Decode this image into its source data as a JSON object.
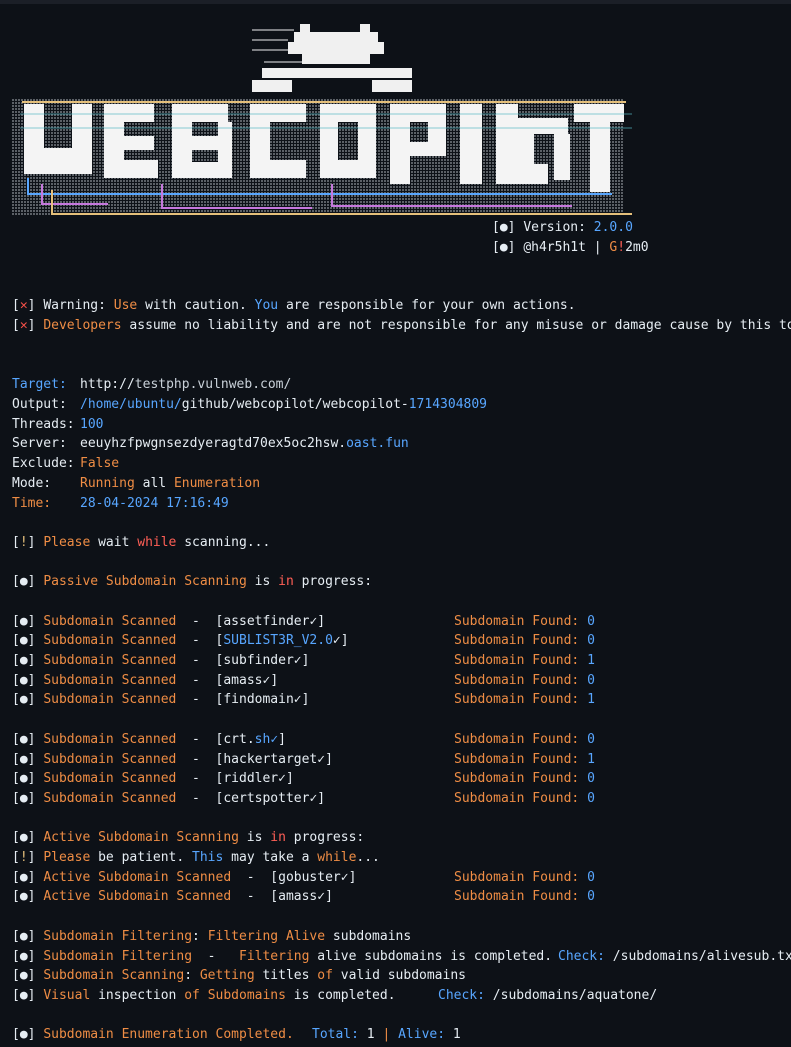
{
  "colors": {
    "background": "#0d1117",
    "orange": "#ef8d45",
    "blue": "#58a6ff",
    "red": "#ff5f56",
    "text": "#e6edf3"
  },
  "banner": {
    "version_label": "Version: ",
    "version": "2.0.0",
    "author": "@h4r5h1t",
    "sep": " | ",
    "author2_a": "G",
    "author2_b": "!",
    "author2_c": "2m0"
  },
  "warnings": [
    {
      "a": "Warning: ",
      "b": "Use",
      "c": " with caution. ",
      "d": "You",
      "e": " are responsible for your own actions."
    },
    {
      "a": "Developers",
      "b": " assume no liability and are not responsible for any misuse or damage cause by this tool"
    }
  ],
  "config": {
    "target_label": "Target:",
    "target_a": "http://",
    "target_b": "testphp.vulnweb.com/",
    "output_label": "Output:",
    "output_a": "/home/ubuntu/",
    "output_b": "github/webcopilot/webcopilot-",
    "output_c": "1714304809",
    "threads_label": "Threads:",
    "threads": "100",
    "server_label": "Server:",
    "server_a": "eeuyhzfpwgnsezdyeragtd70ex5oc2hsw.",
    "server_b": "oast.fun",
    "exclude_label": "Exclude:",
    "exclude": "False",
    "mode_label": "Mode:",
    "mode_a": "Running",
    "mode_b": " all ",
    "mode_c": "Enumeration",
    "time_label": "Time:",
    "time": "28-04-2024 17:16:49"
  },
  "wait": {
    "a": "Please",
    "b": " wait ",
    "c": "while",
    "d": " scanning..."
  },
  "passive_header": {
    "a": "Passive Subdomain Scanning",
    "b": " is ",
    "c": "in",
    "d": " progress:"
  },
  "scanned_label": "Subdomain Scanned",
  "found_label": "Subdomain Found: ",
  "check": "✓",
  "passive_group1": [
    {
      "tool": "assetfinder",
      "found": "0"
    },
    {
      "tool": "SUBLIST3R_V2.0",
      "found": "0"
    },
    {
      "tool": "subfinder",
      "found": "1"
    },
    {
      "tool": "amass",
      "found": "0"
    },
    {
      "tool": "findomain",
      "found": "1"
    }
  ],
  "passive_group2": [
    {
      "tool": "crt.",
      "tool_b": "sh",
      "found": "0"
    },
    {
      "tool": "hackertarget",
      "found": "1"
    },
    {
      "tool": "riddler",
      "found": "0"
    },
    {
      "tool": "certspotter",
      "found": "0"
    }
  ],
  "active_header": {
    "a": "Active Subdomain Scanning",
    "b": " is ",
    "c": "in",
    "d": " progress:"
  },
  "patient": {
    "a": "Please",
    "b": " be patient. ",
    "c": "This",
    "d": " may take a ",
    "e": "while",
    "f": "..."
  },
  "active_label": "Active Subdomain Scanned",
  "active": [
    {
      "tool": "gobuster",
      "found": "0"
    },
    {
      "tool": "amass",
      "found": "0"
    }
  ],
  "filtering1": {
    "a": "Subdomain Filtering",
    "b": ": ",
    "c": "Filtering Alive",
    "d": " subdomains"
  },
  "filtering2": {
    "a": "Subdomain Filtering",
    "b": "  -   ",
    "c": "Filtering",
    "d": " alive subdomains is completed.",
    "e": "Check:",
    "f": " /subdomains/alivesub.txt"
  },
  "scanning_titles": {
    "a": "Subdomain Scanning",
    "b": ": ",
    "c": "Getting",
    "d": " titles ",
    "e": "of",
    "f": " valid subdomains"
  },
  "visual": {
    "a": "Visual",
    "b": " inspection ",
    "c": "of",
    "d": " ",
    "e": "Subdomains",
    "f": " is completed.",
    "g": "Check:",
    "h": " /subdomains/aquatone/"
  },
  "completed": {
    "a": "Subdomain Enumeration Completed.",
    "b": "Total:",
    "c": " 1 ",
    "d": "|",
    "e": " ",
    "f": "Alive:",
    "g": " 1"
  }
}
